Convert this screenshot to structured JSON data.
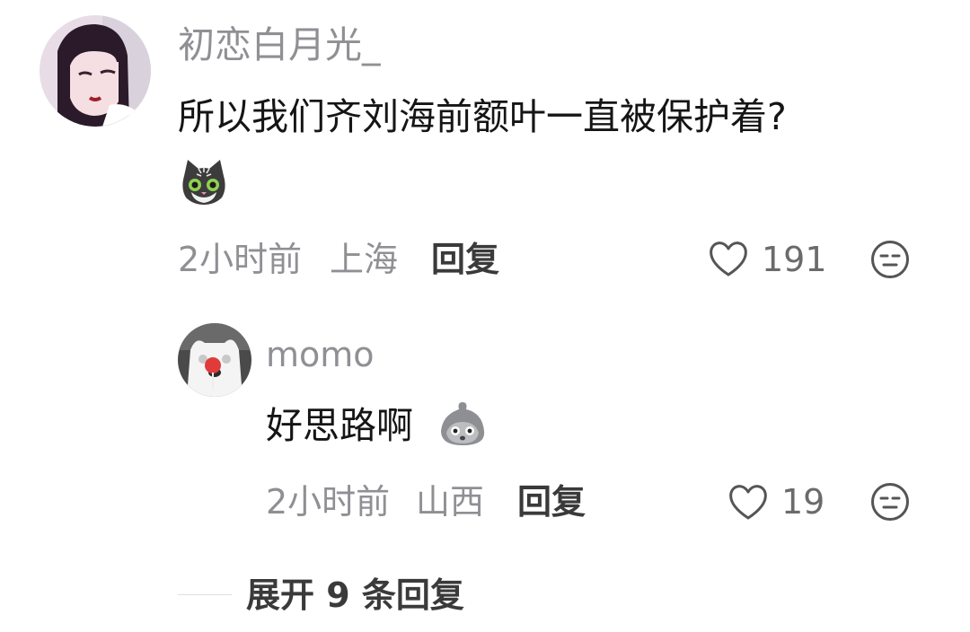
{
  "comments": [
    {
      "username": "初恋白月光_",
      "text": "所以我们齐刘海前额叶一直被保护着?",
      "sticker": "cat-face-icon",
      "time": "2小时前",
      "location": "上海",
      "reply_label": "回复",
      "likes": "191"
    }
  ],
  "replies": [
    {
      "username": "momo",
      "text": "好思路啊",
      "sticker": "grey-blob-face-icon",
      "time": "2小时前",
      "location": "山西",
      "reply_label": "回复",
      "likes": "19"
    }
  ],
  "expand_label": "展开 9 条回复"
}
